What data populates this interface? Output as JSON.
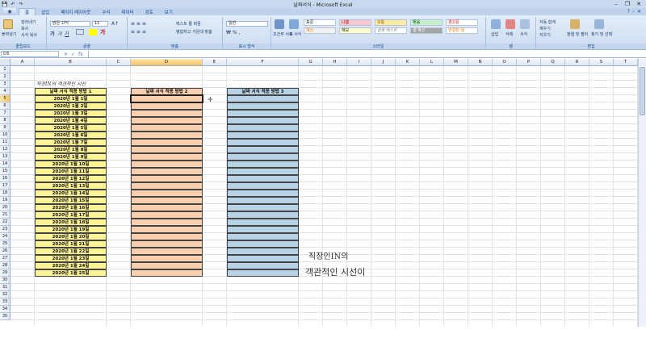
{
  "window": {
    "title": "날짜서식 - Microsoft Excel",
    "minimize": "–",
    "restore": "❐",
    "close": "✕"
  },
  "quick_access": [
    "save",
    "undo",
    "redo"
  ],
  "tabs": [
    {
      "label": "홈",
      "active": true
    },
    {
      "label": "삽입",
      "active": false
    },
    {
      "label": "페이지 레이아웃",
      "active": false
    },
    {
      "label": "수식",
      "active": false
    },
    {
      "label": "데이터",
      "active": false
    },
    {
      "label": "검토",
      "active": false
    },
    {
      "label": "보기",
      "active": false
    }
  ],
  "ribbon": {
    "clipboard": {
      "label": "클립보드",
      "paste": "붙여넣기",
      "cut": "잘라내기",
      "copy": "복사",
      "format_painter": "서식 복사"
    },
    "font": {
      "label": "글꼴",
      "font_name": "맑은 고딕",
      "font_size": "11"
    },
    "alignment": {
      "label": "맞춤",
      "wrap": "텍스트 줄 바꿈",
      "merge": "병합하고 가운데 맞춤"
    },
    "number": {
      "label": "표시 형식",
      "format": "일반"
    },
    "styles": {
      "label": "스타일",
      "conditional": "조건부 서식",
      "table": "표 서식",
      "cells": [
        "표준",
        "나쁨",
        "보통",
        "좋음",
        "경고문",
        "계산",
        "메모",
        "설명 텍스트",
        "셀 확인",
        "연결된 셀"
      ]
    },
    "cells": {
      "label": "셀",
      "insert": "삽입",
      "delete": "삭제",
      "format": "서식"
    },
    "editing": {
      "label": "편집",
      "autosum": "자동 합계",
      "fill": "채우기",
      "clear": "지우기",
      "sort": "정렬 및 필터",
      "find": "찾기 및 선택"
    }
  },
  "formula_bar": {
    "name_box": "D5",
    "fx": "fx",
    "value": ""
  },
  "columns": [
    "A",
    "B",
    "C",
    "D",
    "E",
    "F",
    "G",
    "H",
    "I",
    "J",
    "K",
    "L",
    "M",
    "N",
    "O",
    "P",
    "Q",
    "R",
    "S",
    "T"
  ],
  "selected_column": "D",
  "selected_row": 5,
  "row_count": 35,
  "sheet": {
    "note": "직장IN의 객관적인 시선",
    "col_b_header": "날짜 서식 적용 방법 1",
    "col_d_header": "날짜 서식 적용 방법 2",
    "col_f_header": "날짜 서식 적용 방법 3",
    "dates": [
      "2020년 1월 1일",
      "2020년 1월 2일",
      "2020년 1월 3일",
      "2020년 1월 4일",
      "2020년 1월 5일",
      "2020년 1월 6일",
      "2020년 1월 7일",
      "2020년 1월 8일",
      "2020년 1월 9일",
      "2020년 1월 10일",
      "2020년 1월 11일",
      "2020년 1월 12일",
      "2020년 1월 13일",
      "2020년 1월 14일",
      "2020년 1월 15일",
      "2020년 1월 16일",
      "2020년 1월 17일",
      "2020년 1월 18일",
      "2020년 1월 19일",
      "2020년 1월 20일",
      "2020년 1월 21일",
      "2020년 1월 22일",
      "2020년 1월 23일",
      "2020년 1월 24일",
      "2020년 1월 25일"
    ]
  },
  "watermark": {
    "line1": "직장인IN의",
    "line2": "객관적인 시선이"
  },
  "colors": {
    "yellow": "#fdf495",
    "peach": "#f9cfb0",
    "blue": "#b5d3e4",
    "ribbon": "#dfe9f6"
  }
}
